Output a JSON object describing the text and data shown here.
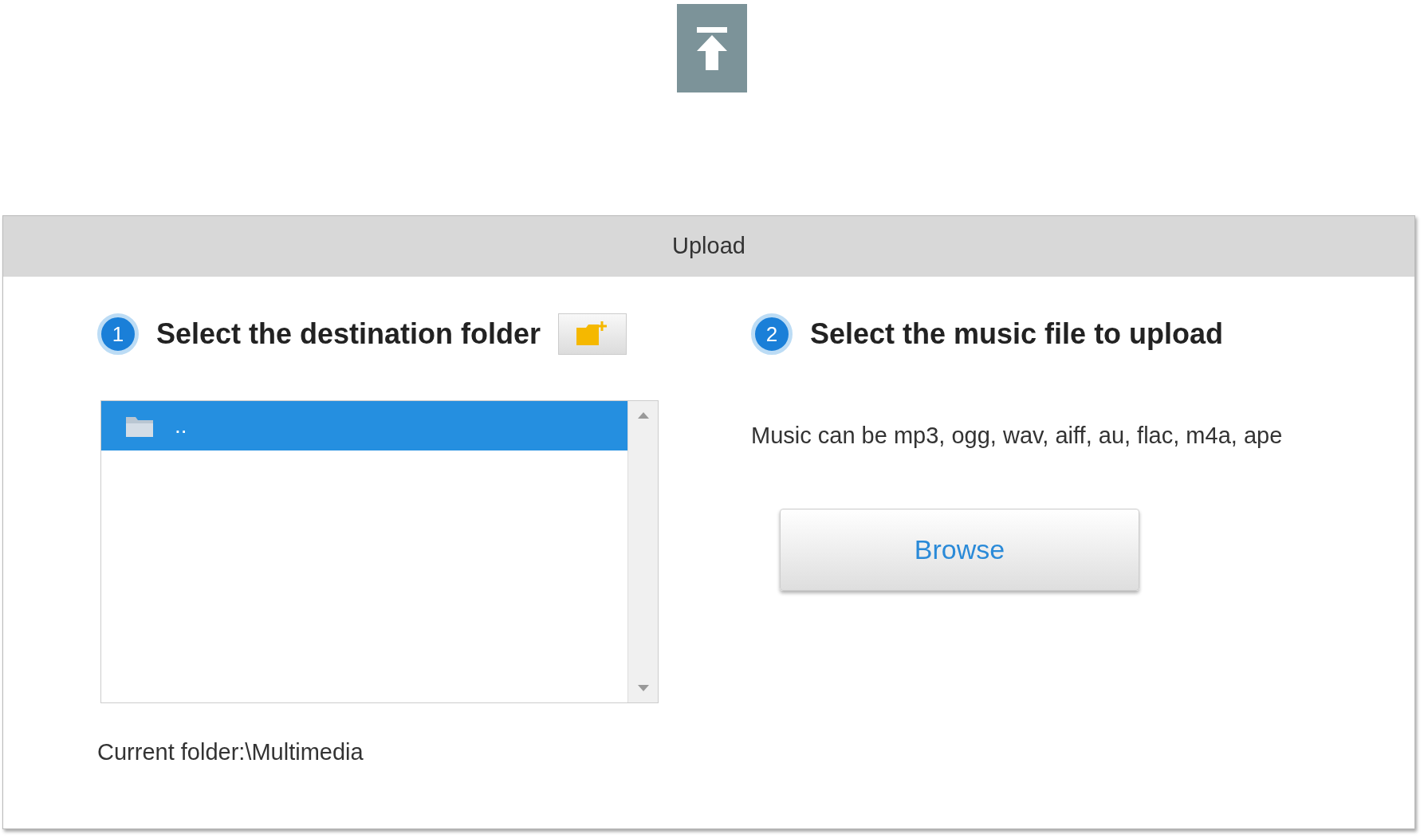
{
  "dialog": {
    "title": "Upload"
  },
  "steps": [
    {
      "number": "1",
      "title": "Select the destination folder"
    },
    {
      "number": "2",
      "title": "Select the music file to upload"
    }
  ],
  "folders": [
    {
      "name": "..",
      "selected": true
    }
  ],
  "current_folder": "Current folder:\\Multimedia",
  "formats_note": "Music can be mp3, ogg, wav, aiff, au, flac, m4a, ape",
  "browse_button": "Browse"
}
